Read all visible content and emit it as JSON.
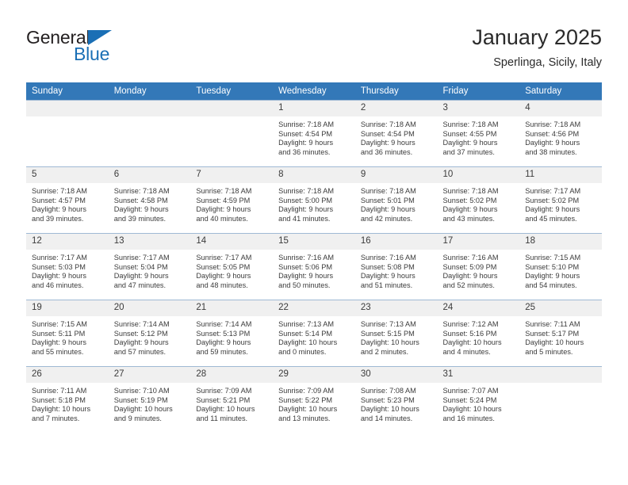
{
  "brand": {
    "word1": "General",
    "word2": "Blue",
    "triangle_color": "#1a6fb5",
    "text_color": "#231f20"
  },
  "header": {
    "title": "January 2025",
    "subtitle": "Sperlinga, Sicily, Italy"
  },
  "theme": {
    "header_row_bg": "#3378b8",
    "header_row_fg": "#ffffff",
    "daynum_bg": "#f0f0f0",
    "cell_border": "#9fb9d4",
    "text": "#3b3b3b"
  },
  "weekdays": [
    "Sunday",
    "Monday",
    "Tuesday",
    "Wednesday",
    "Thursday",
    "Friday",
    "Saturday"
  ],
  "weeks": [
    [
      {
        "day": "",
        "empty": true,
        "lines": []
      },
      {
        "day": "",
        "empty": true,
        "lines": []
      },
      {
        "day": "",
        "empty": true,
        "lines": []
      },
      {
        "day": "1",
        "empty": false,
        "lines": [
          "Sunrise: 7:18 AM",
          "Sunset: 4:54 PM",
          "Daylight: 9 hours",
          "and 36 minutes."
        ]
      },
      {
        "day": "2",
        "empty": false,
        "lines": [
          "Sunrise: 7:18 AM",
          "Sunset: 4:54 PM",
          "Daylight: 9 hours",
          "and 36 minutes."
        ]
      },
      {
        "day": "3",
        "empty": false,
        "lines": [
          "Sunrise: 7:18 AM",
          "Sunset: 4:55 PM",
          "Daylight: 9 hours",
          "and 37 minutes."
        ]
      },
      {
        "day": "4",
        "empty": false,
        "lines": [
          "Sunrise: 7:18 AM",
          "Sunset: 4:56 PM",
          "Daylight: 9 hours",
          "and 38 minutes."
        ]
      }
    ],
    [
      {
        "day": "5",
        "empty": false,
        "lines": [
          "Sunrise: 7:18 AM",
          "Sunset: 4:57 PM",
          "Daylight: 9 hours",
          "and 39 minutes."
        ]
      },
      {
        "day": "6",
        "empty": false,
        "lines": [
          "Sunrise: 7:18 AM",
          "Sunset: 4:58 PM",
          "Daylight: 9 hours",
          "and 39 minutes."
        ]
      },
      {
        "day": "7",
        "empty": false,
        "lines": [
          "Sunrise: 7:18 AM",
          "Sunset: 4:59 PM",
          "Daylight: 9 hours",
          "and 40 minutes."
        ]
      },
      {
        "day": "8",
        "empty": false,
        "lines": [
          "Sunrise: 7:18 AM",
          "Sunset: 5:00 PM",
          "Daylight: 9 hours",
          "and 41 minutes."
        ]
      },
      {
        "day": "9",
        "empty": false,
        "lines": [
          "Sunrise: 7:18 AM",
          "Sunset: 5:01 PM",
          "Daylight: 9 hours",
          "and 42 minutes."
        ]
      },
      {
        "day": "10",
        "empty": false,
        "lines": [
          "Sunrise: 7:18 AM",
          "Sunset: 5:02 PM",
          "Daylight: 9 hours",
          "and 43 minutes."
        ]
      },
      {
        "day": "11",
        "empty": false,
        "lines": [
          "Sunrise: 7:17 AM",
          "Sunset: 5:02 PM",
          "Daylight: 9 hours",
          "and 45 minutes."
        ]
      }
    ],
    [
      {
        "day": "12",
        "empty": false,
        "lines": [
          "Sunrise: 7:17 AM",
          "Sunset: 5:03 PM",
          "Daylight: 9 hours",
          "and 46 minutes."
        ]
      },
      {
        "day": "13",
        "empty": false,
        "lines": [
          "Sunrise: 7:17 AM",
          "Sunset: 5:04 PM",
          "Daylight: 9 hours",
          "and 47 minutes."
        ]
      },
      {
        "day": "14",
        "empty": false,
        "lines": [
          "Sunrise: 7:17 AM",
          "Sunset: 5:05 PM",
          "Daylight: 9 hours",
          "and 48 minutes."
        ]
      },
      {
        "day": "15",
        "empty": false,
        "lines": [
          "Sunrise: 7:16 AM",
          "Sunset: 5:06 PM",
          "Daylight: 9 hours",
          "and 50 minutes."
        ]
      },
      {
        "day": "16",
        "empty": false,
        "lines": [
          "Sunrise: 7:16 AM",
          "Sunset: 5:08 PM",
          "Daylight: 9 hours",
          "and 51 minutes."
        ]
      },
      {
        "day": "17",
        "empty": false,
        "lines": [
          "Sunrise: 7:16 AM",
          "Sunset: 5:09 PM",
          "Daylight: 9 hours",
          "and 52 minutes."
        ]
      },
      {
        "day": "18",
        "empty": false,
        "lines": [
          "Sunrise: 7:15 AM",
          "Sunset: 5:10 PM",
          "Daylight: 9 hours",
          "and 54 minutes."
        ]
      }
    ],
    [
      {
        "day": "19",
        "empty": false,
        "lines": [
          "Sunrise: 7:15 AM",
          "Sunset: 5:11 PM",
          "Daylight: 9 hours",
          "and 55 minutes."
        ]
      },
      {
        "day": "20",
        "empty": false,
        "lines": [
          "Sunrise: 7:14 AM",
          "Sunset: 5:12 PM",
          "Daylight: 9 hours",
          "and 57 minutes."
        ]
      },
      {
        "day": "21",
        "empty": false,
        "lines": [
          "Sunrise: 7:14 AM",
          "Sunset: 5:13 PM",
          "Daylight: 9 hours",
          "and 59 minutes."
        ]
      },
      {
        "day": "22",
        "empty": false,
        "lines": [
          "Sunrise: 7:13 AM",
          "Sunset: 5:14 PM",
          "Daylight: 10 hours",
          "and 0 minutes."
        ]
      },
      {
        "day": "23",
        "empty": false,
        "lines": [
          "Sunrise: 7:13 AM",
          "Sunset: 5:15 PM",
          "Daylight: 10 hours",
          "and 2 minutes."
        ]
      },
      {
        "day": "24",
        "empty": false,
        "lines": [
          "Sunrise: 7:12 AM",
          "Sunset: 5:16 PM",
          "Daylight: 10 hours",
          "and 4 minutes."
        ]
      },
      {
        "day": "25",
        "empty": false,
        "lines": [
          "Sunrise: 7:11 AM",
          "Sunset: 5:17 PM",
          "Daylight: 10 hours",
          "and 5 minutes."
        ]
      }
    ],
    [
      {
        "day": "26",
        "empty": false,
        "lines": [
          "Sunrise: 7:11 AM",
          "Sunset: 5:18 PM",
          "Daylight: 10 hours",
          "and 7 minutes."
        ]
      },
      {
        "day": "27",
        "empty": false,
        "lines": [
          "Sunrise: 7:10 AM",
          "Sunset: 5:19 PM",
          "Daylight: 10 hours",
          "and 9 minutes."
        ]
      },
      {
        "day": "28",
        "empty": false,
        "lines": [
          "Sunrise: 7:09 AM",
          "Sunset: 5:21 PM",
          "Daylight: 10 hours",
          "and 11 minutes."
        ]
      },
      {
        "day": "29",
        "empty": false,
        "lines": [
          "Sunrise: 7:09 AM",
          "Sunset: 5:22 PM",
          "Daylight: 10 hours",
          "and 13 minutes."
        ]
      },
      {
        "day": "30",
        "empty": false,
        "lines": [
          "Sunrise: 7:08 AM",
          "Sunset: 5:23 PM",
          "Daylight: 10 hours",
          "and 14 minutes."
        ]
      },
      {
        "day": "31",
        "empty": false,
        "lines": [
          "Sunrise: 7:07 AM",
          "Sunset: 5:24 PM",
          "Daylight: 10 hours",
          "and 16 minutes."
        ]
      },
      {
        "day": "",
        "empty": true,
        "lines": []
      }
    ]
  ]
}
